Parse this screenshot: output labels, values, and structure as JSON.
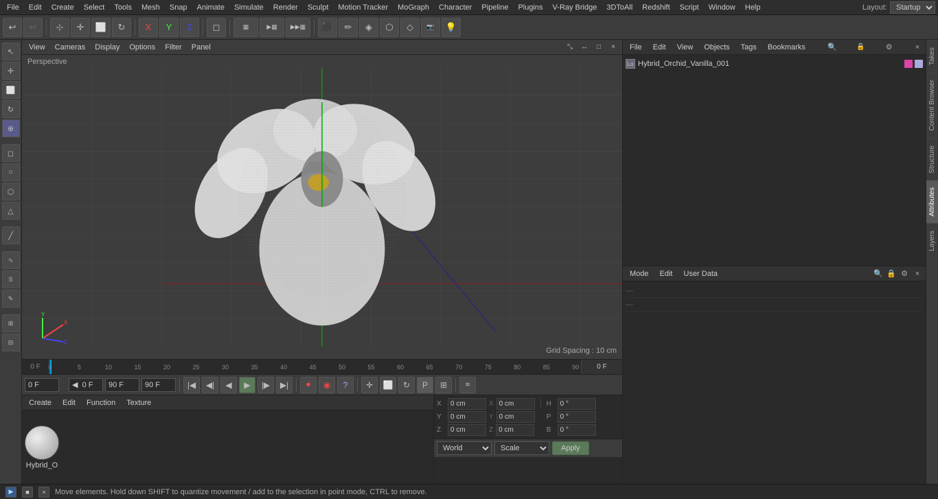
{
  "menubar": {
    "items": [
      "File",
      "Edit",
      "Create",
      "Select",
      "Tools",
      "Mesh",
      "Snap",
      "Animate",
      "Simulate",
      "Render",
      "Sculpt",
      "Motion Tracker",
      "MoGraph",
      "Character",
      "Pipeline",
      "Plugins",
      "V-Ray Bridge",
      "3DToAll",
      "Redshift",
      "Script",
      "Window",
      "Help"
    ],
    "layout_label": "Layout:",
    "layout_value": "Startup"
  },
  "viewport": {
    "label": "Perspective",
    "menus": [
      "View",
      "Cameras",
      "Display",
      "Options",
      "Filter",
      "Panel"
    ],
    "grid_spacing": "Grid Spacing : 10 cm"
  },
  "object_manager": {
    "toolbar_menus": [
      "File",
      "Edit",
      "View",
      "Objects",
      "Tags",
      "Bookmarks"
    ],
    "object_name": "Hybrid_Orchid_Vanilla_001"
  },
  "attr_manager": {
    "toolbar_menus": [
      "Mode",
      "Edit",
      "User Data"
    ],
    "dashes1": "---",
    "dashes2": "---"
  },
  "coordinates": {
    "x_label": "X",
    "y_label": "Y",
    "z_label": "Z",
    "x_val1": "0 cm",
    "x_val2": "0 cm",
    "y_val1": "0 cm",
    "y_val2": "0 cm",
    "z_val1": "0 cm",
    "z_val2": "0 cm",
    "h_label": "H",
    "p_label": "P",
    "b_label": "B",
    "h_val": "0 °",
    "p_val": "0 °",
    "b_val": "0 °",
    "world_label": "World",
    "scale_label": "Scale",
    "apply_label": "Apply"
  },
  "timeline": {
    "start_frame": "0 F",
    "end_preview": "90 F",
    "end_frame": "90 F",
    "current_frame": "0 F",
    "ticks": [
      0,
      5,
      10,
      15,
      20,
      25,
      30,
      35,
      40,
      45,
      50,
      55,
      60,
      65,
      70,
      75,
      80,
      85,
      90
    ]
  },
  "material": {
    "toolbar_menus": [
      "Create",
      "Edit",
      "Function",
      "Texture"
    ],
    "name": "Hybrid_O"
  },
  "status_bar": {
    "text": "Move elements. Hold down SHIFT to quantize movement / add to the selection in point mode, CTRL to remove."
  },
  "right_tabs": [
    "Takes",
    "Content Browser",
    "Structure",
    "Attributes",
    "Layers"
  ]
}
